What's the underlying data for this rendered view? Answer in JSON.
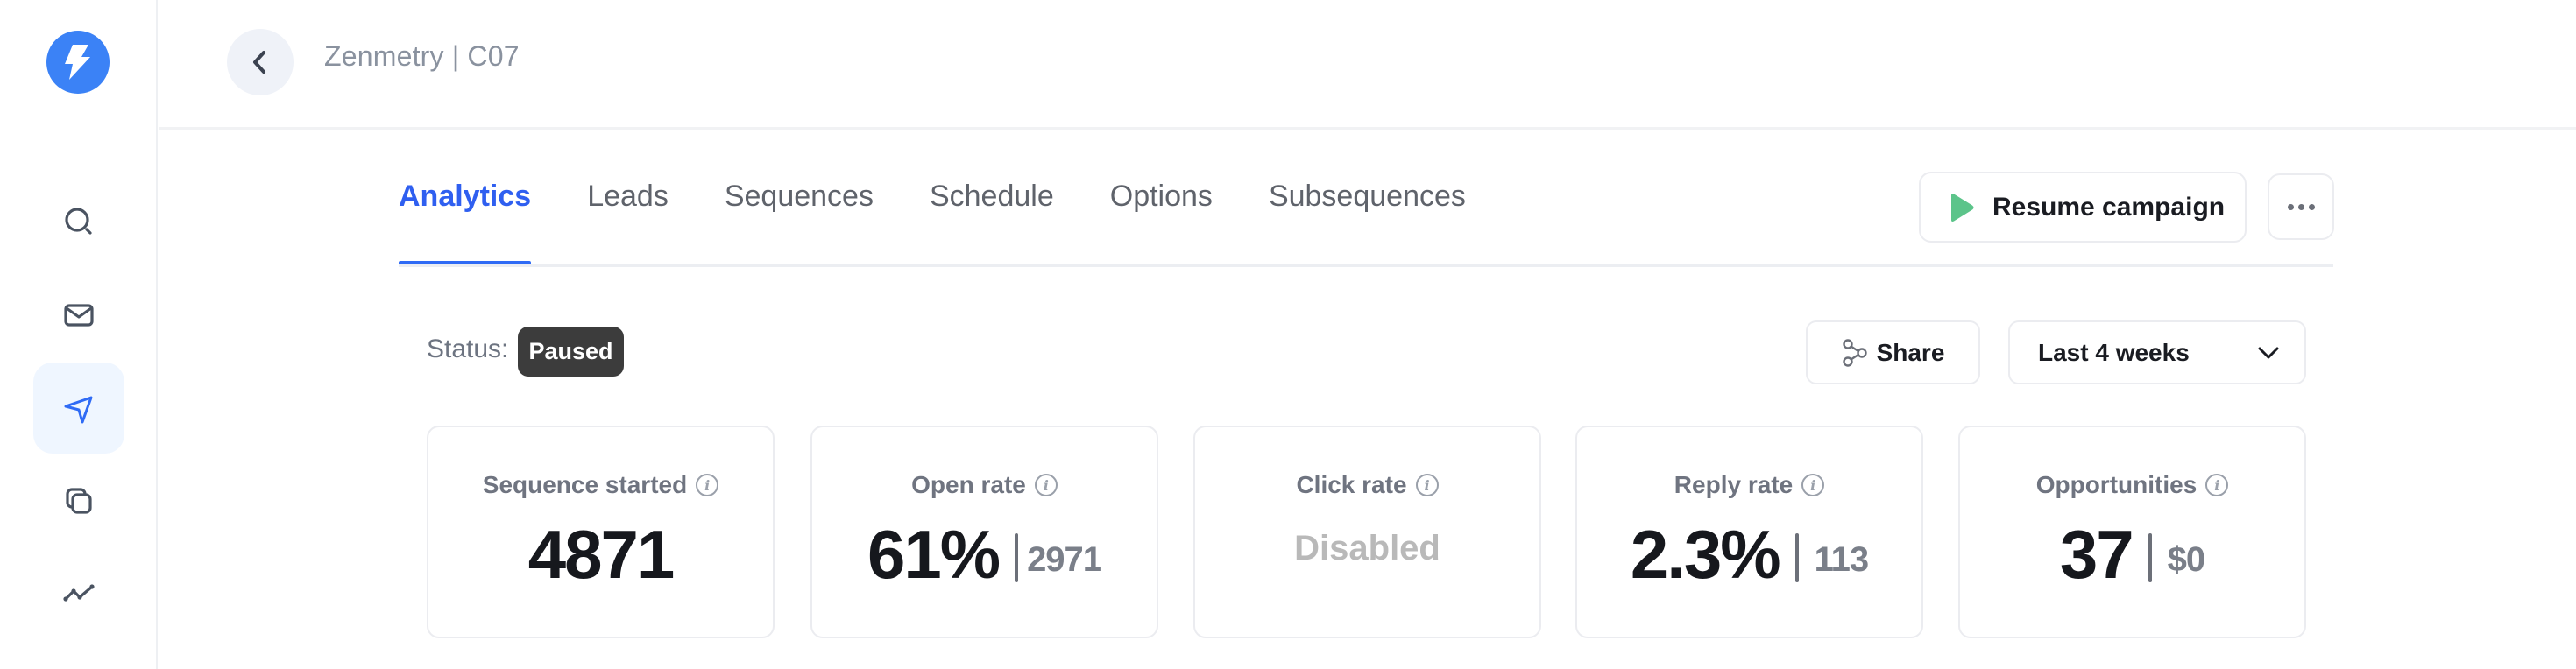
{
  "app": {
    "logo_icon": "lightning-bolt-icon"
  },
  "header": {
    "title": "Zenmetry | C07",
    "back_icon": "chevron-left-icon"
  },
  "sidebar": {
    "items": [
      {
        "name": "search",
        "icon": "search-icon",
        "active": false
      },
      {
        "name": "inbox",
        "icon": "mail-icon",
        "active": false
      },
      {
        "name": "campaigns",
        "icon": "send-icon",
        "active": true
      },
      {
        "name": "templates",
        "icon": "copy-icon",
        "active": false
      },
      {
        "name": "analytics",
        "icon": "trend-icon",
        "active": false
      }
    ]
  },
  "tabs": [
    {
      "label": "Analytics",
      "active": true
    },
    {
      "label": "Leads",
      "active": false
    },
    {
      "label": "Sequences",
      "active": false
    },
    {
      "label": "Schedule",
      "active": false
    },
    {
      "label": "Options",
      "active": false
    },
    {
      "label": "Subsequences",
      "active": false
    }
  ],
  "actions": {
    "resume_label": "Resume campaign",
    "more_icon": "more-horizontal-icon"
  },
  "status": {
    "label": "Status:",
    "value": "Paused"
  },
  "toolbar": {
    "share_label": "Share",
    "range_selected": "Last 4 weeks"
  },
  "metrics": [
    {
      "label": "Sequence started",
      "value": "4871",
      "secondary": null,
      "disabled": false
    },
    {
      "label": "Open rate",
      "value": "61%",
      "secondary": "2971",
      "disabled": false
    },
    {
      "label": "Click rate",
      "value": "Disabled",
      "secondary": null,
      "disabled": true
    },
    {
      "label": "Reply rate",
      "value": "2.3%",
      "secondary": "113",
      "disabled": false
    },
    {
      "label": "Opportunities",
      "value": "37",
      "secondary": "$0",
      "disabled": false
    }
  ],
  "colors": {
    "accent": "#2f6bf5",
    "logo": "#3b82f6",
    "resume_icon": "#5cc48a",
    "status_badge": "#3c3c3c"
  }
}
